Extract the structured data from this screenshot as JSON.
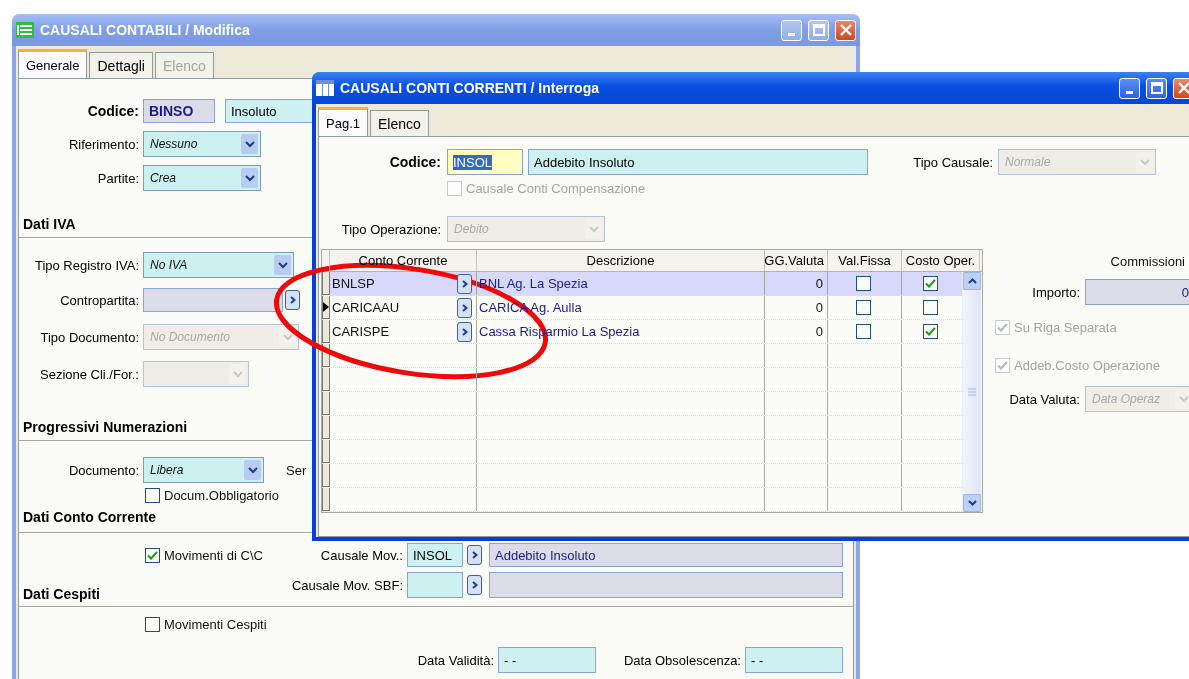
{
  "back_window": {
    "title": "CAUSALI CONTABILI / Modifica",
    "tabs": [
      {
        "label": "Generale",
        "selected": true,
        "disabled": false
      },
      {
        "label": "Dettagli",
        "selected": false,
        "disabled": false
      },
      {
        "label": "Elenco",
        "selected": false,
        "disabled": true
      }
    ],
    "codice": {
      "label": "Codice:",
      "code": "BINSO",
      "description": "Insoluto"
    },
    "riferimento": {
      "label": "Riferimento:",
      "value": "Nessuno",
      "disabled": false
    },
    "partite": {
      "label": "Partite:",
      "value": "Crea",
      "disabled": false
    },
    "section_iva": "Dati IVA",
    "tipo_registro": {
      "label": "Tipo Registro IVA:",
      "value": "No IVA",
      "disabled": false
    },
    "contropartita": {
      "label": "Contropartita:"
    },
    "tipo_documento": {
      "label": "Tipo Documento:",
      "value": "No Documento",
      "disabled": true
    },
    "sezione": {
      "label": "Sezione Cli./For.:",
      "disabled": true
    },
    "section_progressivi": "Progressivi Numerazioni",
    "documento": {
      "label": "Documento:",
      "value": "Libera",
      "disabled": false
    },
    "serie_label": "Ser",
    "docum_obbligatorio": {
      "label": "Docum.Obbligatorio",
      "checked": false
    },
    "section_cc": "Dati Conto Corrente",
    "movimenti_cc": {
      "label": "Movimenti di C\\C",
      "checked": true
    },
    "causale_mov": {
      "label": "Causale Mov.:",
      "code": "INSOL",
      "description": "Addebito Insoluto"
    },
    "causale_sbf": {
      "label": "Causale Mov. SBF:"
    },
    "section_cespiti": "Dati Cespiti",
    "movimenti_cespiti": {
      "label": "Movimenti Cespiti",
      "checked": false
    },
    "data_validita": {
      "label": "Data Validità:",
      "value": "- -"
    },
    "data_obsolescenza": {
      "label": "Data Obsolescenza:",
      "value": "- -"
    }
  },
  "front_window": {
    "title": "CAUSALI CONTI CORRENTI / Interroga",
    "tabs": [
      {
        "label": "Pag.1",
        "selected": true,
        "disabled": false
      },
      {
        "label": "Elenco",
        "selected": false,
        "disabled": false
      }
    ],
    "codice": {
      "label": "Codice:",
      "code": "INSOL",
      "text_selected": true,
      "description": "Addebito Insoluto"
    },
    "tipo_causale": {
      "label": "Tipo Causale:",
      "value": "Normale",
      "disabled": true
    },
    "compensazione": {
      "label": "Causale Conti Compensazione",
      "checked": false,
      "disabled": true
    },
    "tipo_operazione": {
      "label": "Tipo Operazione:",
      "value": "Debito",
      "disabled": true
    },
    "table": {
      "columns": [
        "Conto Corrente",
        "Descrizione",
        "GG.Valuta",
        "Val.Fissa",
        "Costo Oper."
      ],
      "rows": [
        {
          "conto": "BNLSP",
          "descrizione": "BNL Ag. La Spezia",
          "gg_valuta": "0",
          "val_fissa": false,
          "costo_oper": true,
          "selected": true,
          "current": false
        },
        {
          "conto": "CARICAAU",
          "descrizione": "CARICA Ag. Aulla",
          "gg_valuta": "0",
          "val_fissa": false,
          "costo_oper": false,
          "selected": false,
          "current": true
        },
        {
          "conto": "CARISPE",
          "descrizione": "Cassa Risparmio La Spezia",
          "gg_valuta": "0",
          "val_fissa": false,
          "costo_oper": true,
          "selected": false,
          "current": false
        }
      ]
    },
    "commissioni": {
      "title": "Commissioni",
      "importo": {
        "label": "Importo:",
        "value": "0"
      },
      "su_riga": {
        "label": "Su Riga Separata",
        "checked": true,
        "disabled": true
      },
      "addebito": {
        "label": "Addeb.Costo Operazione",
        "checked": true,
        "disabled": true
      },
      "data_valuta": {
        "label": "Data Valuta:",
        "value": "Data Operaz",
        "disabled": true
      }
    }
  },
  "annotation": {
    "kind": "ellipse"
  }
}
